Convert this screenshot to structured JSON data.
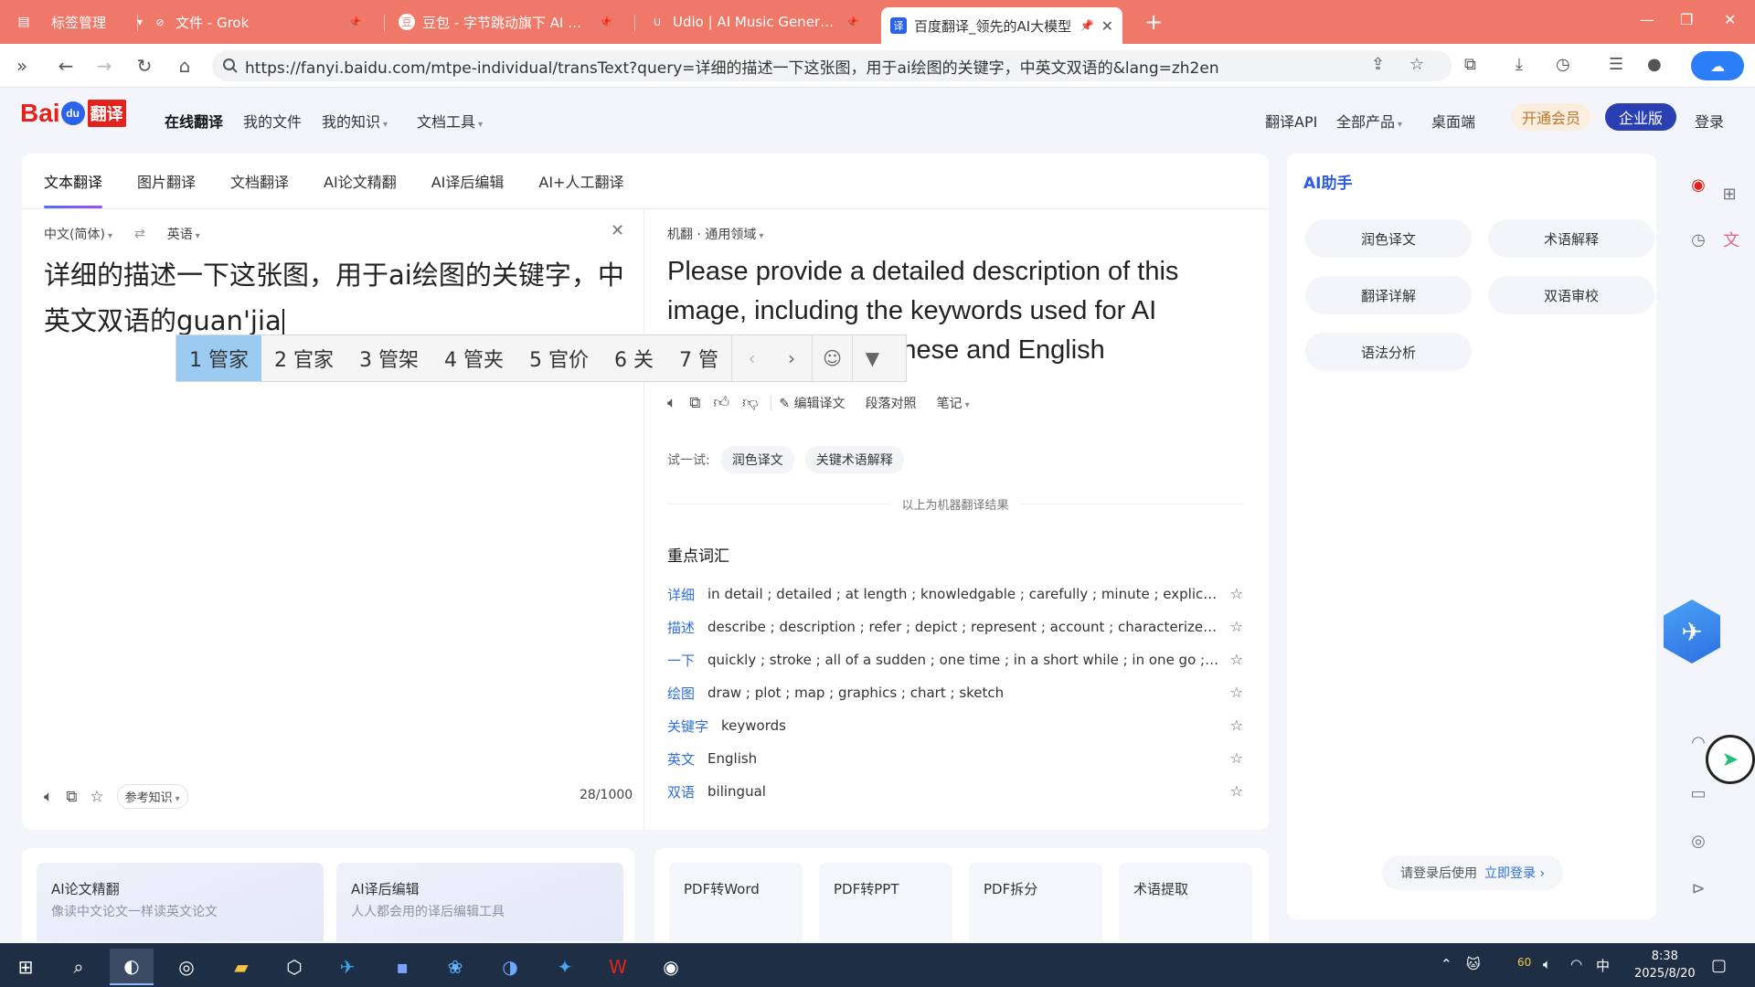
{
  "browser": {
    "tabs": [
      {
        "label": "标签管理",
        "icon": "tab-manager-icon"
      },
      {
        "label": "文件 - Grok",
        "icon": "grok-icon"
      },
      {
        "label": "豆包 - 字节跳动旗下 AI 智能",
        "icon": "doubao-icon"
      },
      {
        "label": "Udio | AI Music Generator",
        "icon": "udio-icon"
      },
      {
        "label": "百度翻译_领先的AI大模型",
        "icon": "baidu-translate-icon",
        "active": true
      }
    ],
    "url": "https://fanyi.baidu.com/mtpe-individual/transText?query=详细的描述一下这张图，用于ai绘图的关键字，中英文双语的&lang=zh2en"
  },
  "site": {
    "logo_text": "Bai",
    "logo_du": "du",
    "logo_fanyi": "翻译",
    "nav": [
      "在线翻译",
      "我的文件",
      "我的知识",
      "文档工具"
    ],
    "right_nav": [
      "翻译API",
      "全部产品",
      "桌面端"
    ],
    "vip": "开通会员",
    "enterprise": "企业版",
    "login": "登录"
  },
  "mode_tabs": [
    "文本翻译",
    "图片翻译",
    "文档翻译",
    "AI论文精翻",
    "AI译后编辑",
    "AI+人工翻译"
  ],
  "source": {
    "lang_from": "中文(简体)",
    "lang_to": "英语",
    "text": "详细的描述一下这张图，用于ai绘图的关键字，中英文双语的guan'jia",
    "ref_knowledge": "参考知识",
    "char_count": "28/1000"
  },
  "target": {
    "meta": "机翻 · 通用领域",
    "text": "Please provide a detailed description of this image, including the keywords used for AI drawing, in both Chinese and English",
    "tools": [
      "编辑译文",
      "段落对照",
      "笔记"
    ],
    "try_label": "试一试:",
    "try_chips": [
      "润色译文",
      "关键术语解释"
    ],
    "mt_note": "以上为机器翻译结果",
    "vocab_title": "重点词汇",
    "vocab": [
      {
        "word": "详细",
        "meaning": "in detail ; detailed ; at length ; knowledgable ; carefully ; minute ; explicit ; ..."
      },
      {
        "word": "描述",
        "meaning": "describe ; description ; refer ; depict ; represent ; account ; characterize ; ..."
      },
      {
        "word": "一下",
        "meaning": "quickly ; stroke ; all of a sudden ; one time ; in a short while ; in one go ; ..."
      },
      {
        "word": "绘图",
        "meaning": "draw ; plot ; map ; graphics ; chart ; sketch"
      },
      {
        "word": "关键字",
        "meaning": "keywords"
      },
      {
        "word": "英文",
        "meaning": "English"
      },
      {
        "word": "双语",
        "meaning": "bilingual"
      }
    ]
  },
  "ime": {
    "candidates": [
      "1 管家",
      "2 官家",
      "3 管架",
      "4 管夹",
      "5 官价",
      "6 关",
      "7 管"
    ]
  },
  "assistant": {
    "title": "AI助手",
    "buttons": [
      "润色译文",
      "术语解释",
      "翻译详解",
      "双语审校",
      "语法分析"
    ],
    "login_prompt": "请登录后使用",
    "login_link": "立即登录 ›"
  },
  "promos": [
    {
      "title": "AI论文精翻",
      "sub": "像读中文论文一样读英文论文"
    },
    {
      "title": "AI译后编辑",
      "sub": "人人都会用的译后编辑工具"
    }
  ],
  "tools": [
    "PDF转Word",
    "PDF转PPT",
    "PDF拆分",
    "术语提取"
  ],
  "taskbar": {
    "tray_battery": "60",
    "tray_ime": "中",
    "time": "8:38",
    "date": "2025/8/20"
  }
}
